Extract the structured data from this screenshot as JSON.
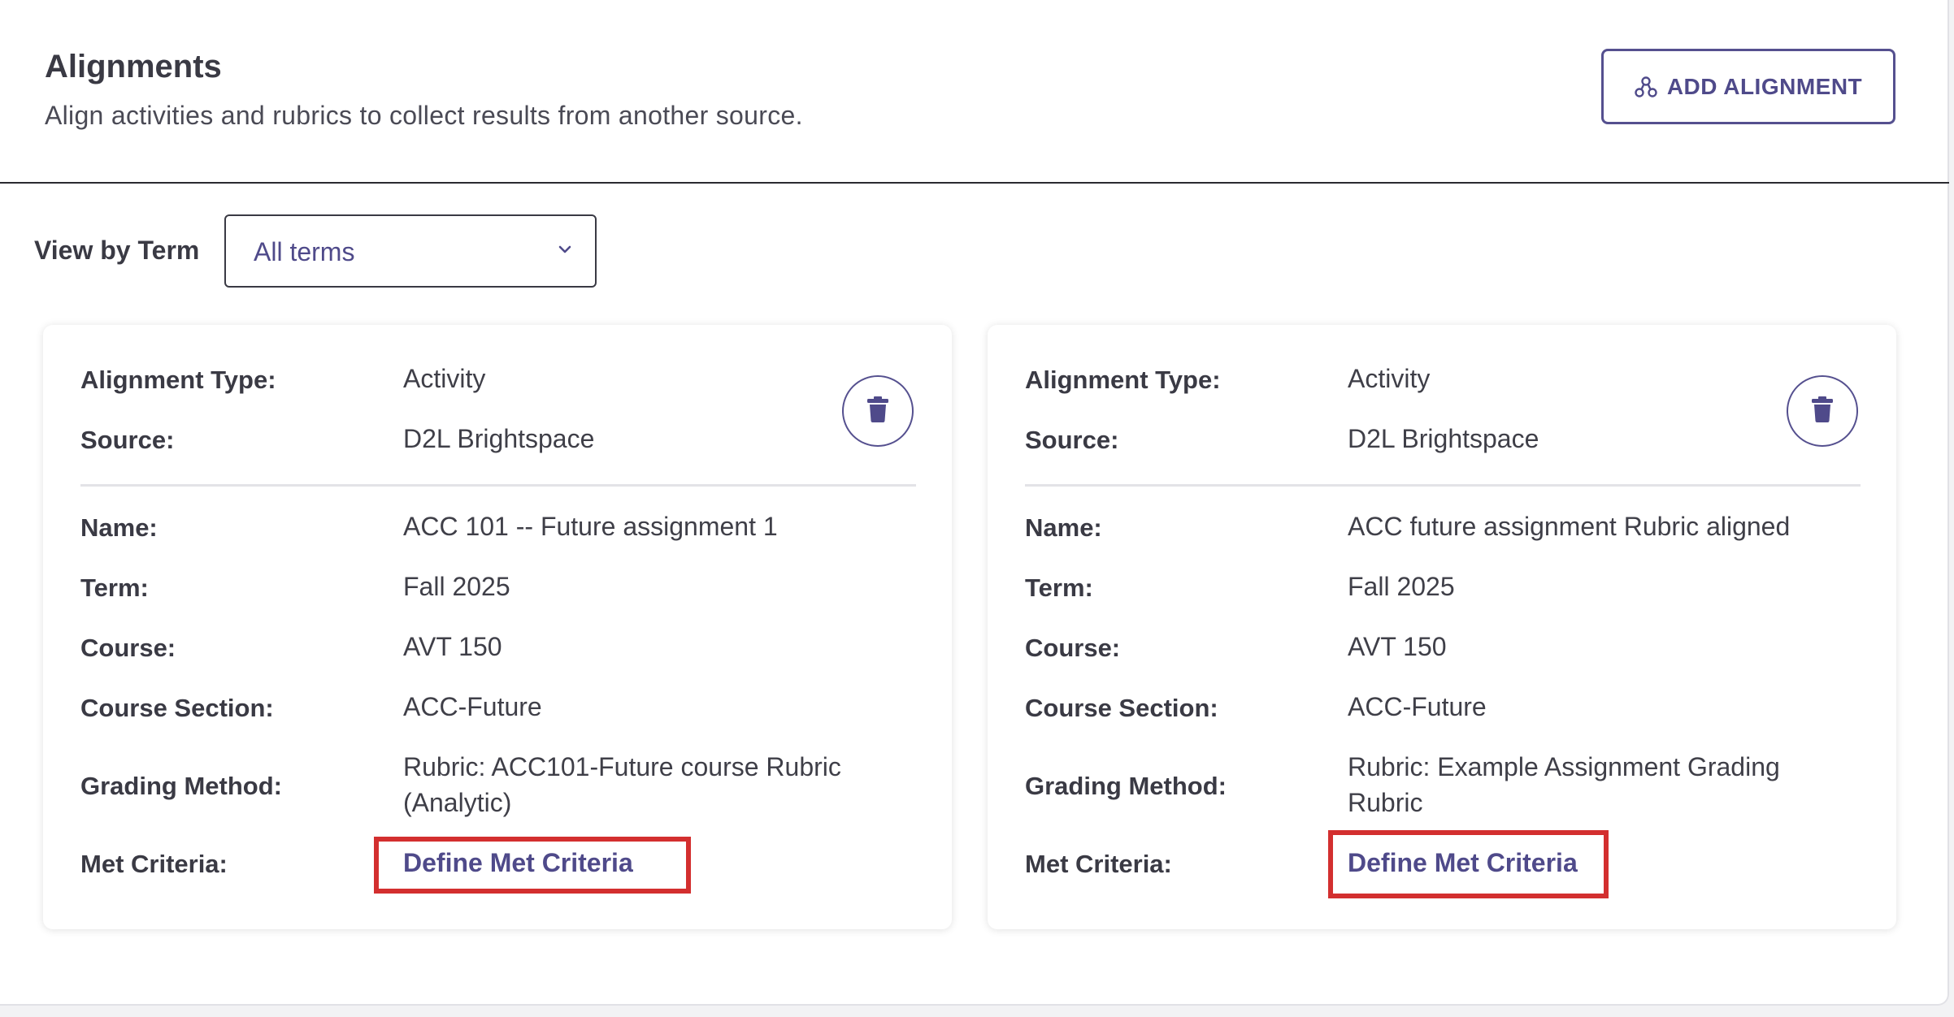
{
  "header": {
    "title": "Alignments",
    "subtitle": "Align activities and rubrics to collect results from another source.",
    "add_button_label": "ADD ALIGNMENT",
    "add_button_icon": "alignment-network-icon"
  },
  "filter": {
    "label": "View by Term",
    "selected": "All terms"
  },
  "colors": {
    "accent": "#4f4a8a",
    "highlight": "#d32f2f"
  },
  "cards": [
    {
      "alignment_type_label": "Alignment Type:",
      "alignment_type": "Activity",
      "source_label": "Source:",
      "source": "D2L Brightspace",
      "name_label": "Name:",
      "name": "ACC 101 -- Future assignment 1",
      "term_label": "Term:",
      "term": "Fall 2025",
      "course_label": "Course:",
      "course": "AVT 150",
      "section_label": "Course Section:",
      "section": "ACC-Future",
      "grading_label": "Grading Method:",
      "grading_line1": "Rubric: ACC101-Future course Rubric",
      "grading_line2": "(Analytic)",
      "met_label": "Met Criteria:",
      "met_link": "Define Met Criteria"
    },
    {
      "alignment_type_label": "Alignment Type:",
      "alignment_type": "Activity",
      "source_label": "Source:",
      "source": "D2L Brightspace",
      "name_label": "Name:",
      "name": "ACC future assignment Rubric aligned",
      "term_label": "Term:",
      "term": "Fall 2025",
      "course_label": "Course:",
      "course": "AVT 150",
      "section_label": "Course Section:",
      "section": "ACC-Future",
      "grading_label": "Grading Method:",
      "grading_line1": "Rubric: Example Assignment Grading",
      "grading_line2": "Rubric",
      "met_label": "Met Criteria:",
      "met_link": "Define Met Criteria"
    }
  ]
}
